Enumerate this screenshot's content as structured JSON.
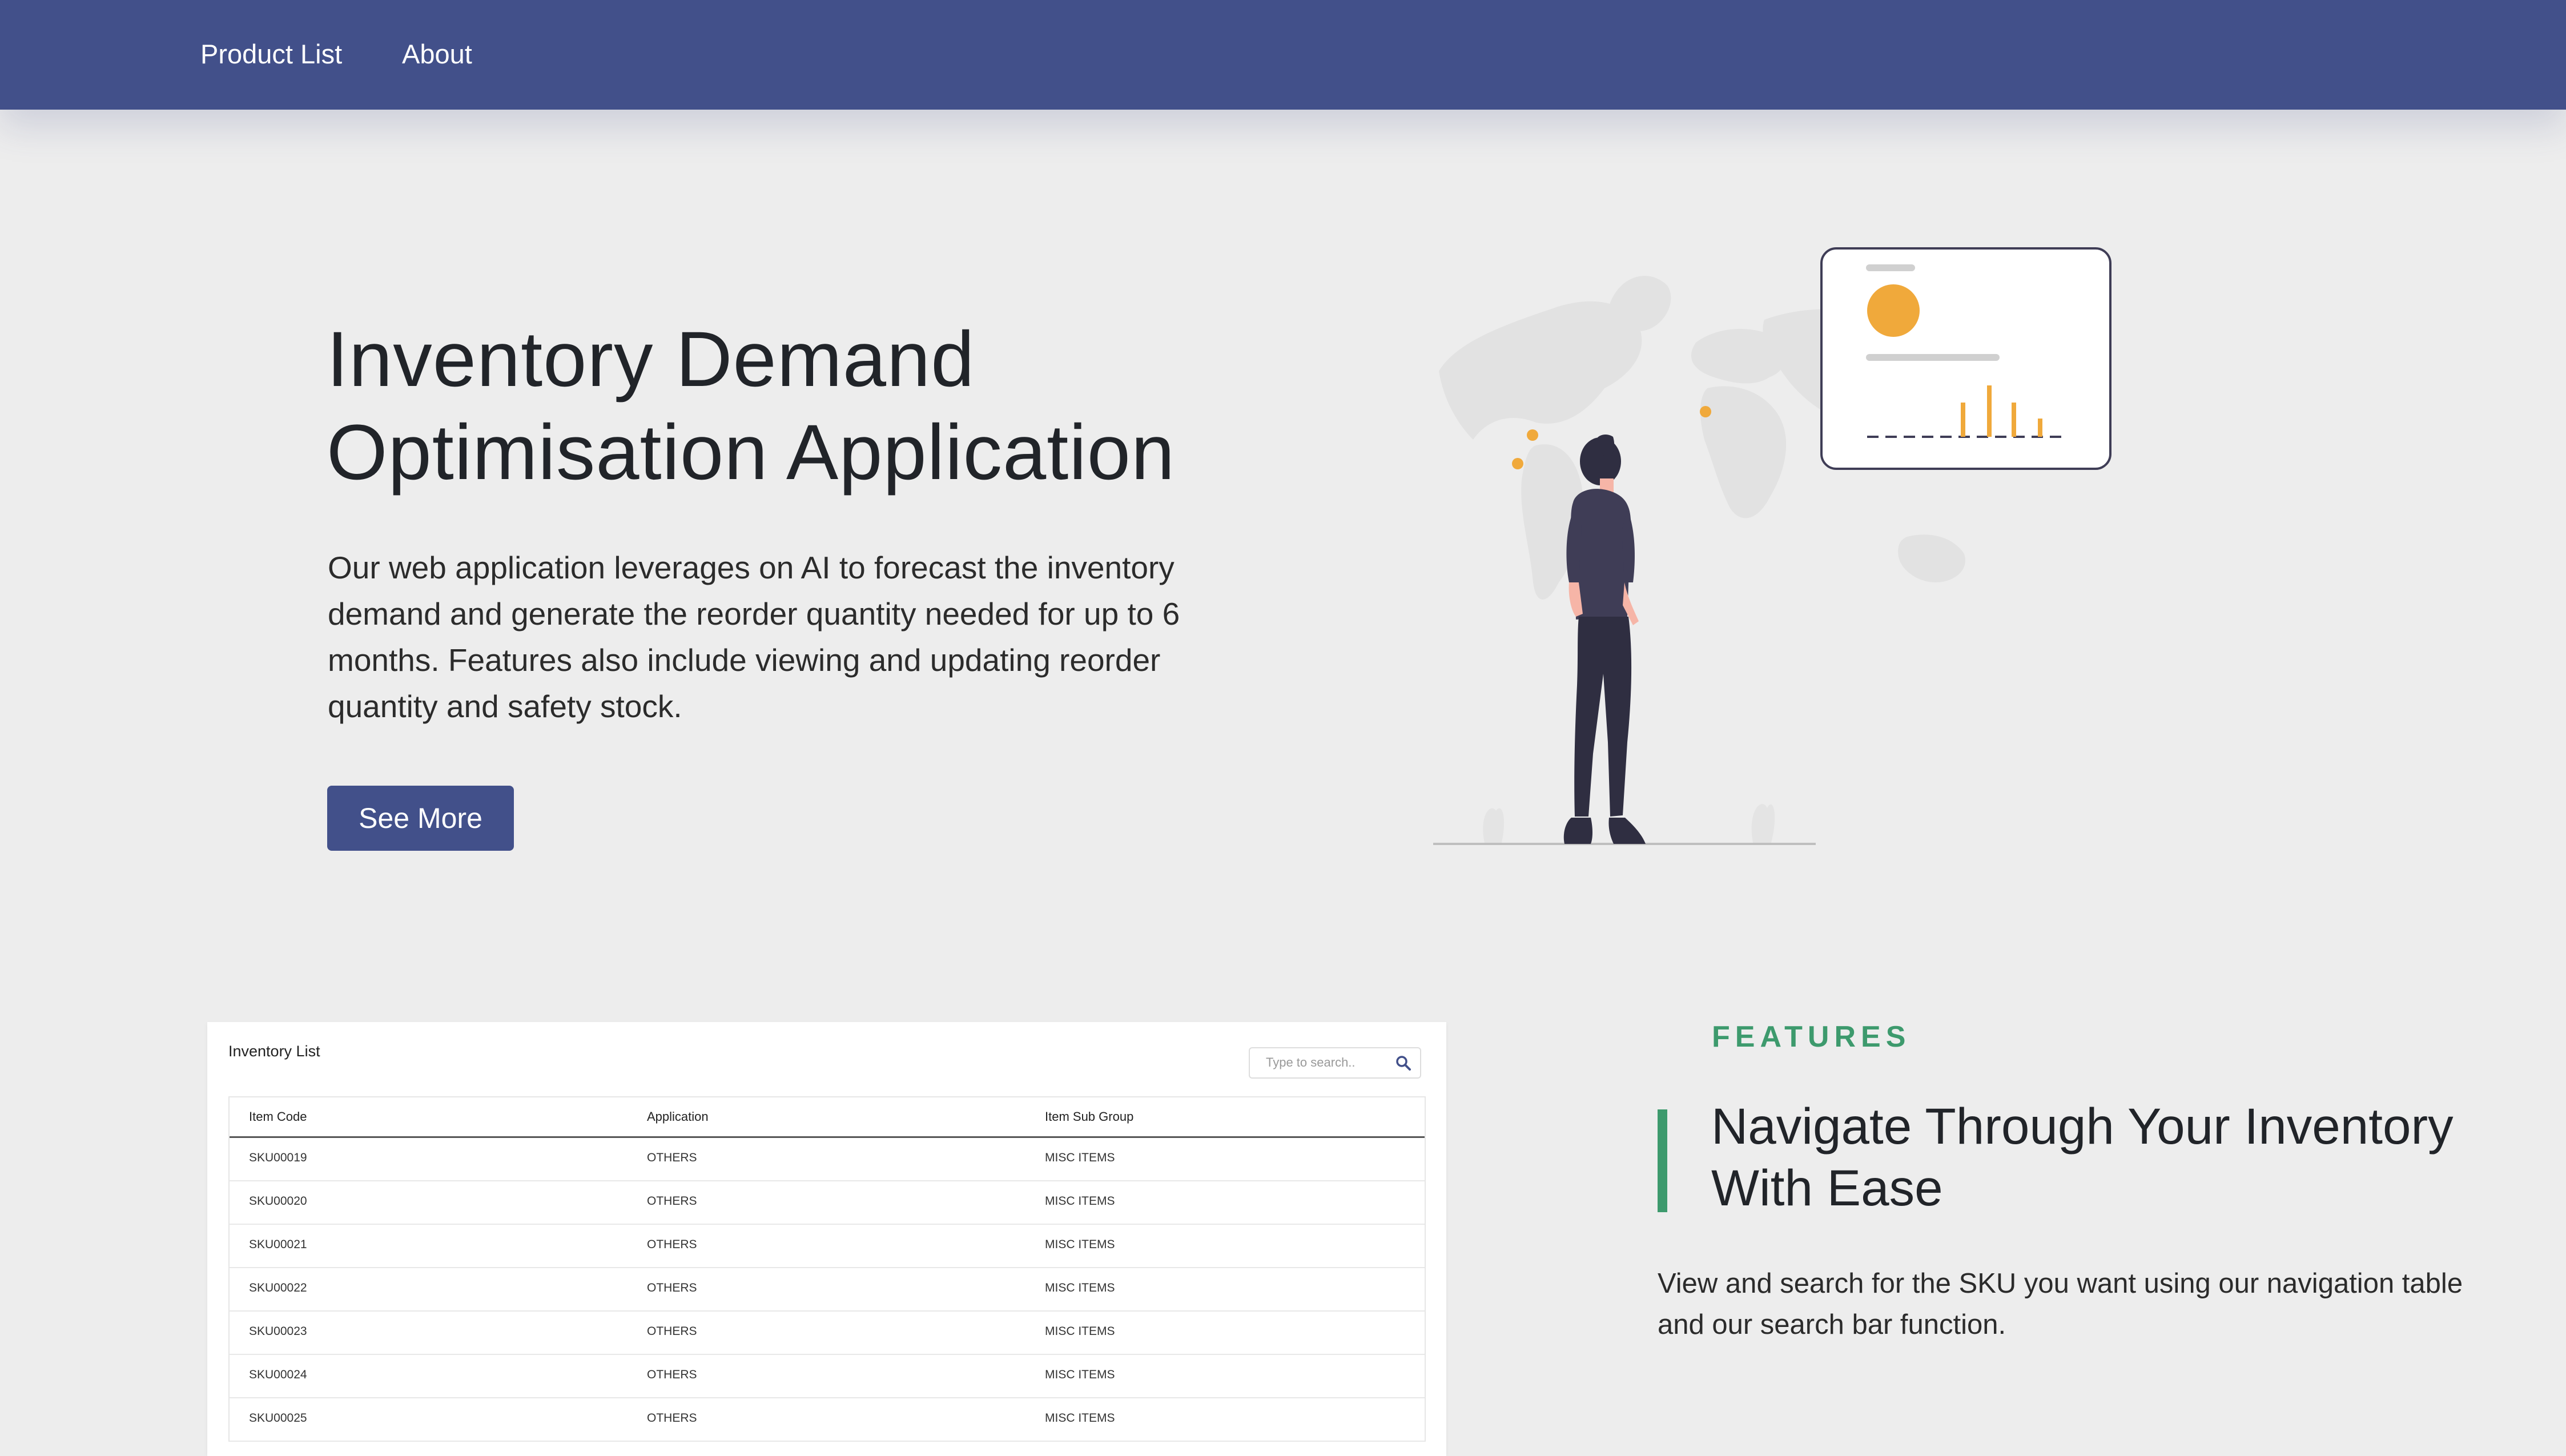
{
  "nav": {
    "links": [
      "Product List",
      "About"
    ]
  },
  "hero": {
    "title_line1": "Inventory Demand",
    "title_line2": "Optimisation Application",
    "description": "Our web application leverages on AI to forecast the inventory demand and generate the reorder quantity needed for up to 6 months. Features also include viewing and updating reorder quantity and safety stock.",
    "cta_label": "See More"
  },
  "preview": {
    "title": "Inventory List",
    "search_placeholder": "Type to search..",
    "columns": [
      "Item Code",
      "Application",
      "Item Sub Group"
    ],
    "rows": [
      [
        "SKU00019",
        "OTHERS",
        "MISC ITEMS"
      ],
      [
        "SKU00020",
        "OTHERS",
        "MISC ITEMS"
      ],
      [
        "SKU00021",
        "OTHERS",
        "MISC ITEMS"
      ],
      [
        "SKU00022",
        "OTHERS",
        "MISC ITEMS"
      ],
      [
        "SKU00023",
        "OTHERS",
        "MISC ITEMS"
      ],
      [
        "SKU00024",
        "OTHERS",
        "MISC ITEMS"
      ],
      [
        "SKU00025",
        "OTHERS",
        "MISC ITEMS"
      ]
    ]
  },
  "features": {
    "eyebrow": "FEATURES",
    "heading": "Navigate Through Your Inventory With Ease",
    "description": "View and search for the SKU you want using our navigation table and our search bar function."
  },
  "colors": {
    "primary": "#42508a",
    "accent_green": "#3d9a6d",
    "accent_orange": "#f0a93b",
    "background": "#ededed"
  },
  "icons": [
    "search-icon",
    "person-illustration",
    "world-map-illustration",
    "dashboard-card-illustration"
  ]
}
